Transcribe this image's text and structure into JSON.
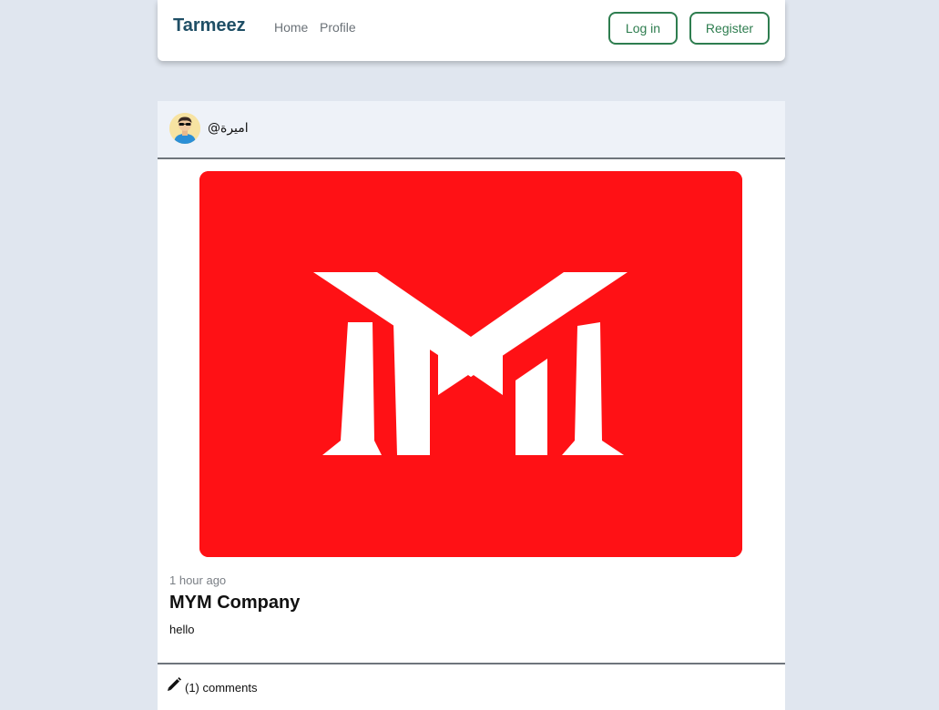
{
  "navbar": {
    "brand": "Tarmeez",
    "links": [
      "Home",
      "Profile"
    ],
    "login_label": "Log in",
    "register_label": "Register",
    "accent_color": "#2e7d4f"
  },
  "post": {
    "username": "@اميرة",
    "time": "1 hour ago",
    "title": "MYM Company",
    "body": "hello",
    "comments_label": "(1) comments",
    "image_bg_color": "#ff1115"
  },
  "icons": {
    "avatar": "user-avatar-sunglasses",
    "edit": "pencil-icon"
  }
}
